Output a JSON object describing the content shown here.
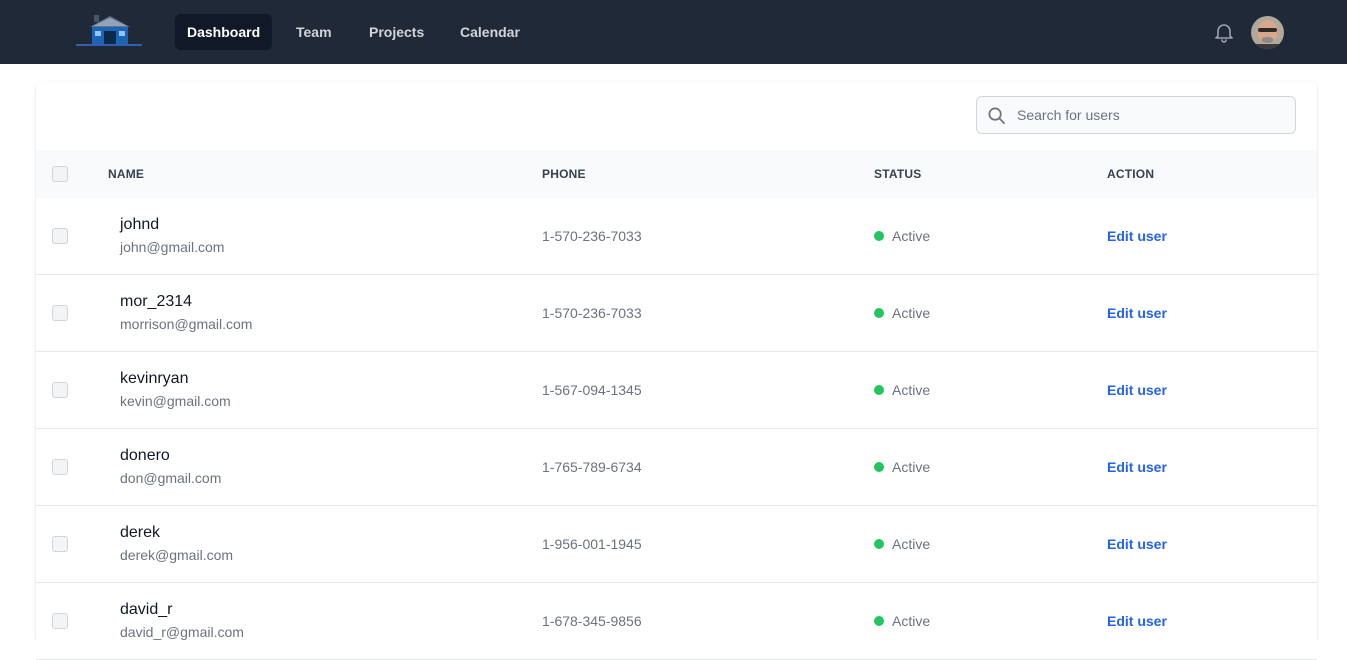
{
  "nav": {
    "links": [
      {
        "label": "Dashboard",
        "active": true
      },
      {
        "label": "Team",
        "active": false
      },
      {
        "label": "Projects",
        "active": false
      },
      {
        "label": "Calendar",
        "active": false
      }
    ]
  },
  "search": {
    "placeholder": "Search for users",
    "value": ""
  },
  "table": {
    "headers": {
      "name": "NAME",
      "phone": "PHONE",
      "status": "STATUS",
      "action": "ACTION"
    },
    "rows": [
      {
        "username": "johnd",
        "email": "john@gmail.com",
        "phone": "1-570-236-7033",
        "status": "Active",
        "action": "Edit user"
      },
      {
        "username": "mor_2314",
        "email": "morrison@gmail.com",
        "phone": "1-570-236-7033",
        "status": "Active",
        "action": "Edit user"
      },
      {
        "username": "kevinryan",
        "email": "kevin@gmail.com",
        "phone": "1-567-094-1345",
        "status": "Active",
        "action": "Edit user"
      },
      {
        "username": "donero",
        "email": "don@gmail.com",
        "phone": "1-765-789-6734",
        "status": "Active",
        "action": "Edit user"
      },
      {
        "username": "derek",
        "email": "derek@gmail.com",
        "phone": "1-956-001-1945",
        "status": "Active",
        "action": "Edit user"
      },
      {
        "username": "david_r",
        "email": "david_r@gmail.com",
        "phone": "1-678-345-9856",
        "status": "Active",
        "action": "Edit user"
      }
    ]
  },
  "colors": {
    "navbar": "#1f2937",
    "nav_active": "#111827",
    "status_active": "#22c55e",
    "link": "#2563eb"
  }
}
